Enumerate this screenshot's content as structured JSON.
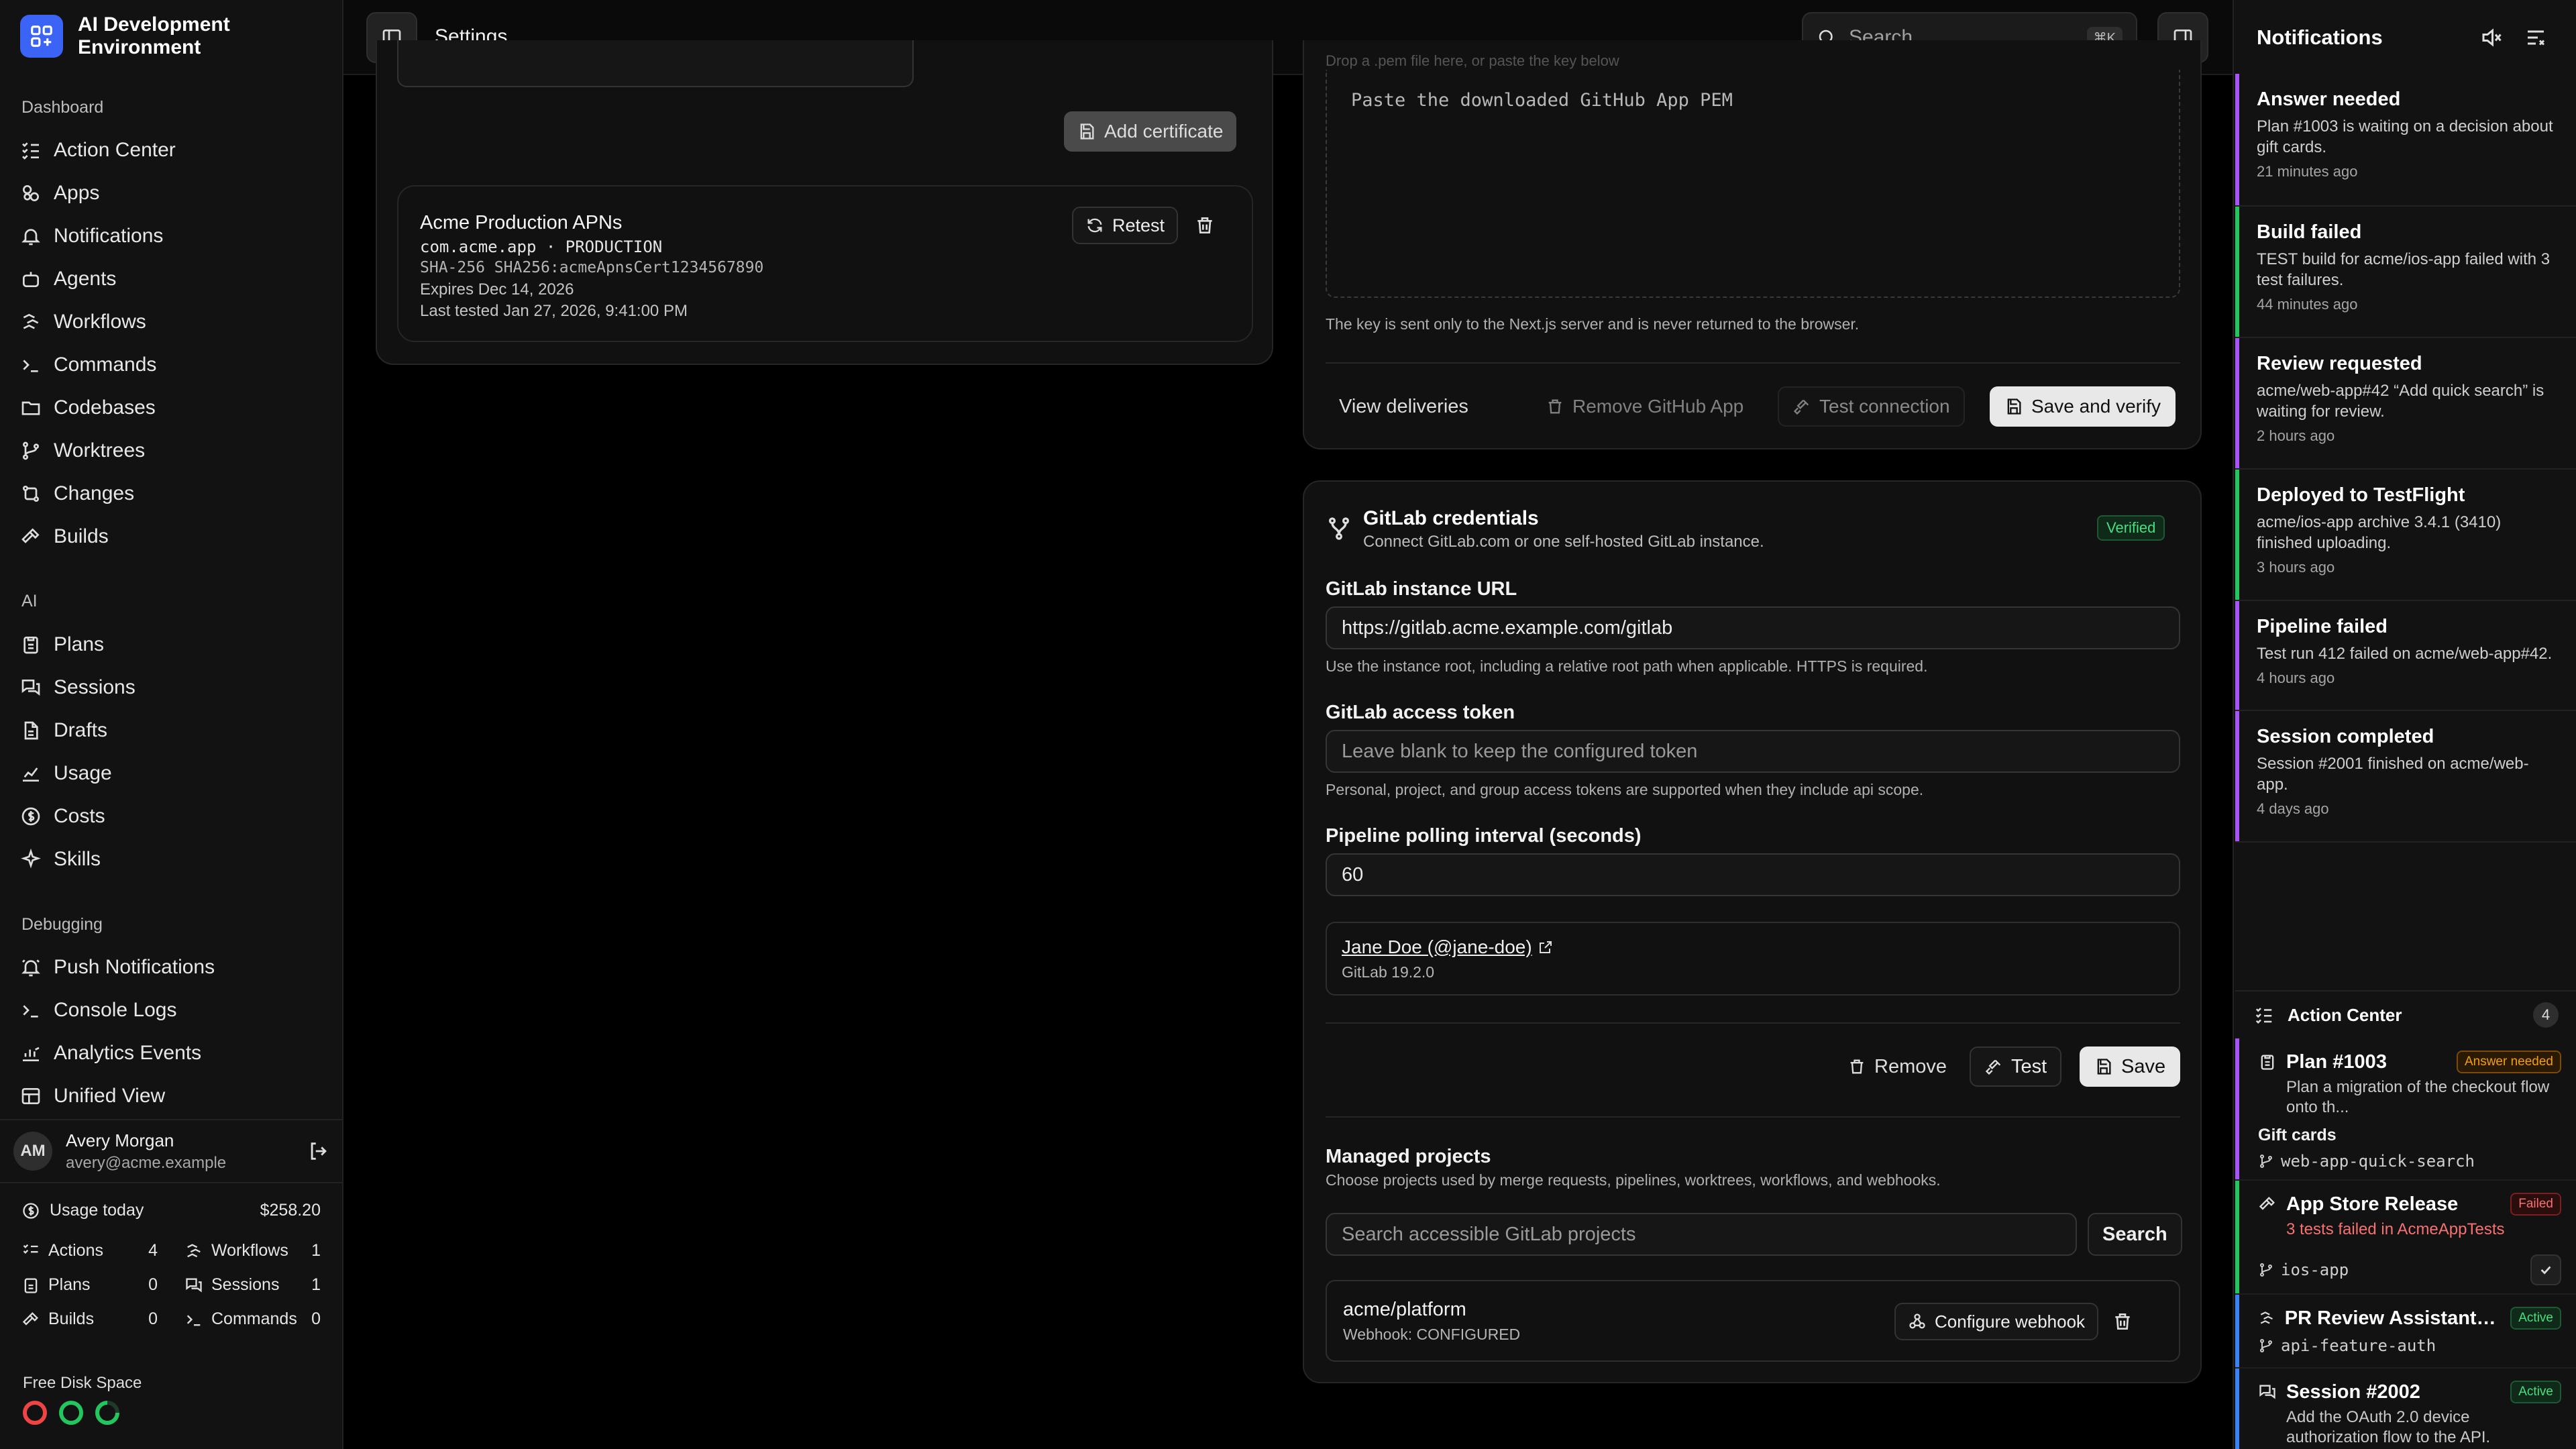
{
  "app": {
    "name": "AI Development Environment",
    "page_title": "Settings"
  },
  "sidebar": {
    "sections": [
      {
        "label": "Dashboard",
        "items": [
          {
            "label": "Action Center",
            "icon": "list-checks-icon"
          },
          {
            "label": "Apps",
            "icon": "apps-icon"
          },
          {
            "label": "Notifications",
            "icon": "bell-icon"
          },
          {
            "label": "Agents",
            "icon": "bot-icon"
          },
          {
            "label": "Workflows",
            "icon": "workflow-icon"
          },
          {
            "label": "Commands",
            "icon": "terminal-icon"
          },
          {
            "label": "Codebases",
            "icon": "folder-icon"
          },
          {
            "label": "Worktrees",
            "icon": "git-branch-icon"
          },
          {
            "label": "Changes",
            "icon": "git-compare-icon"
          },
          {
            "label": "Builds",
            "icon": "hammer-icon"
          }
        ]
      },
      {
        "label": "AI",
        "items": [
          {
            "label": "Plans",
            "icon": "clipboard-icon"
          },
          {
            "label": "Sessions",
            "icon": "messages-icon"
          },
          {
            "label": "Drafts",
            "icon": "file-icon"
          },
          {
            "label": "Usage",
            "icon": "chart-icon"
          },
          {
            "label": "Costs",
            "icon": "dollar-icon"
          },
          {
            "label": "Skills",
            "icon": "sparkles-icon"
          }
        ]
      },
      {
        "label": "Debugging",
        "items": [
          {
            "label": "Push Notifications",
            "icon": "bell-ring-icon"
          },
          {
            "label": "Console Logs",
            "icon": "terminal-icon"
          },
          {
            "label": "Analytics Events",
            "icon": "analytics-icon"
          },
          {
            "label": "Unified View",
            "icon": "layout-icon"
          }
        ]
      }
    ],
    "user": {
      "initials": "AM",
      "name": "Avery Morgan",
      "email": "avery@acme.example"
    },
    "usage": {
      "label": "Usage today",
      "value": "$258.20"
    },
    "stats": [
      {
        "label": "Actions",
        "value": "4"
      },
      {
        "label": "Workflows",
        "value": "1"
      },
      {
        "label": "Plans",
        "value": "0"
      },
      {
        "label": "Sessions",
        "value": "1"
      },
      {
        "label": "Builds",
        "value": "0"
      },
      {
        "label": "Commands",
        "value": "0"
      }
    ],
    "disk_label": "Free Disk Space",
    "disk_colors": [
      "#ef4444",
      "#22c55e",
      "#22c55e"
    ]
  },
  "topbar": {
    "search_placeholder": "Search",
    "search_shortcut": "⌘K"
  },
  "apns": {
    "add_certificate": "Add certificate",
    "cert": {
      "name": "Acme Production APNs",
      "bundle": "com.acme.app · PRODUCTION",
      "sha": "SHA-256 SHA256:acmeApnsCert1234567890",
      "expires": "Expires Dec 14, 2026",
      "tested": "Last tested Jan 27, 2026, 9:41:00 PM",
      "retest": "Retest"
    }
  },
  "github_app": {
    "drop_hint": "Drop a .pem file here, or paste the key below",
    "pem_placeholder": "Paste the downloaded GitHub App PEM",
    "key_help": "The key is sent only to the Next.js server and is never returned to the browser.",
    "view_deliveries": "View deliveries",
    "remove": "Remove GitHub App",
    "test": "Test connection",
    "save": "Save and verify"
  },
  "gitlab": {
    "title": "GitLab credentials",
    "subtitle": "Connect GitLab.com or one self-hosted GitLab instance.",
    "badge": "Verified",
    "url_label": "GitLab instance URL",
    "url_value": "https://gitlab.acme.example.com/gitlab",
    "url_help": "Use the instance root, including a relative root path when applicable. HTTPS is required.",
    "token_label": "GitLab access token",
    "token_placeholder": "Leave blank to keep the configured token",
    "token_help": "Personal, project, and group access tokens are supported when they include api scope.",
    "poll_label": "Pipeline polling interval (seconds)",
    "poll_value": "60",
    "account_name": "Jane Doe (@jane-doe)",
    "account_version": "GitLab 19.2.0",
    "remove": "Remove",
    "test": "Test",
    "save": "Save",
    "managed_title": "Managed projects",
    "managed_sub": "Choose projects used by merge requests, pipelines, worktrees, workflows, and webhooks.",
    "project_search_placeholder": "Search accessible GitLab projects",
    "search_button": "Search",
    "project": {
      "name": "acme/platform",
      "webhook": "Webhook: CONFIGURED",
      "configure": "Configure webhook"
    }
  },
  "notifications": {
    "title": "Notifications",
    "items": [
      {
        "title": "Answer needed",
        "desc": "Plan #1003 is waiting on a decision about gift cards.",
        "time": "21 minutes ago",
        "color": "#a855f7"
      },
      {
        "title": "Build failed",
        "desc": "TEST build for acme/ios-app failed with 3 test failures.",
        "time": "44 minutes ago",
        "color": "#22c55e"
      },
      {
        "title": "Review requested",
        "desc": "acme/web-app#42 “Add quick search” is waiting for review.",
        "time": "2 hours ago",
        "color": "#a855f7"
      },
      {
        "title": "Deployed to TestFlight",
        "desc": "acme/ios-app archive 3.4.1 (3410) finished uploading.",
        "time": "3 hours ago",
        "color": "#22c55e"
      },
      {
        "title": "Pipeline failed",
        "desc": "Test run 412 failed on acme/web-app#42.",
        "time": "4 hours ago",
        "color": "#a855f7"
      },
      {
        "title": "Session completed",
        "desc": "Session #2001 finished on acme/web-app.",
        "time": "4 days ago",
        "color": "#a855f7"
      }
    ]
  },
  "action_center": {
    "title": "Action Center",
    "count": "4",
    "items": [
      {
        "title": "Plan #1003",
        "badge": "Answer needed",
        "desc": "Plan a migration of the checkout flow onto th...",
        "extra": "Gift cards",
        "branch": "web-app-quick-search",
        "color": "#a855f7",
        "badge_color": "#f59e0b"
      },
      {
        "title": "App Store Release",
        "badge": "Failed",
        "desc": "3 tests failed in AcmeAppTests",
        "branch": "ios-app",
        "color": "#22c55e",
        "badge_color": "#ef4444"
      },
      {
        "title": "PR Review Assistant #4...",
        "badge": "Active",
        "branch": "api-feature-auth",
        "color": "#3b82f6",
        "badge_color": "#22c55e"
      },
      {
        "title": "Session #2002",
        "badge": "Active",
        "desc": "Add the OAuth 2.0 device authorization flow to the API.",
        "color": "#3b82f6",
        "badge_color": "#22c55e"
      }
    ]
  }
}
